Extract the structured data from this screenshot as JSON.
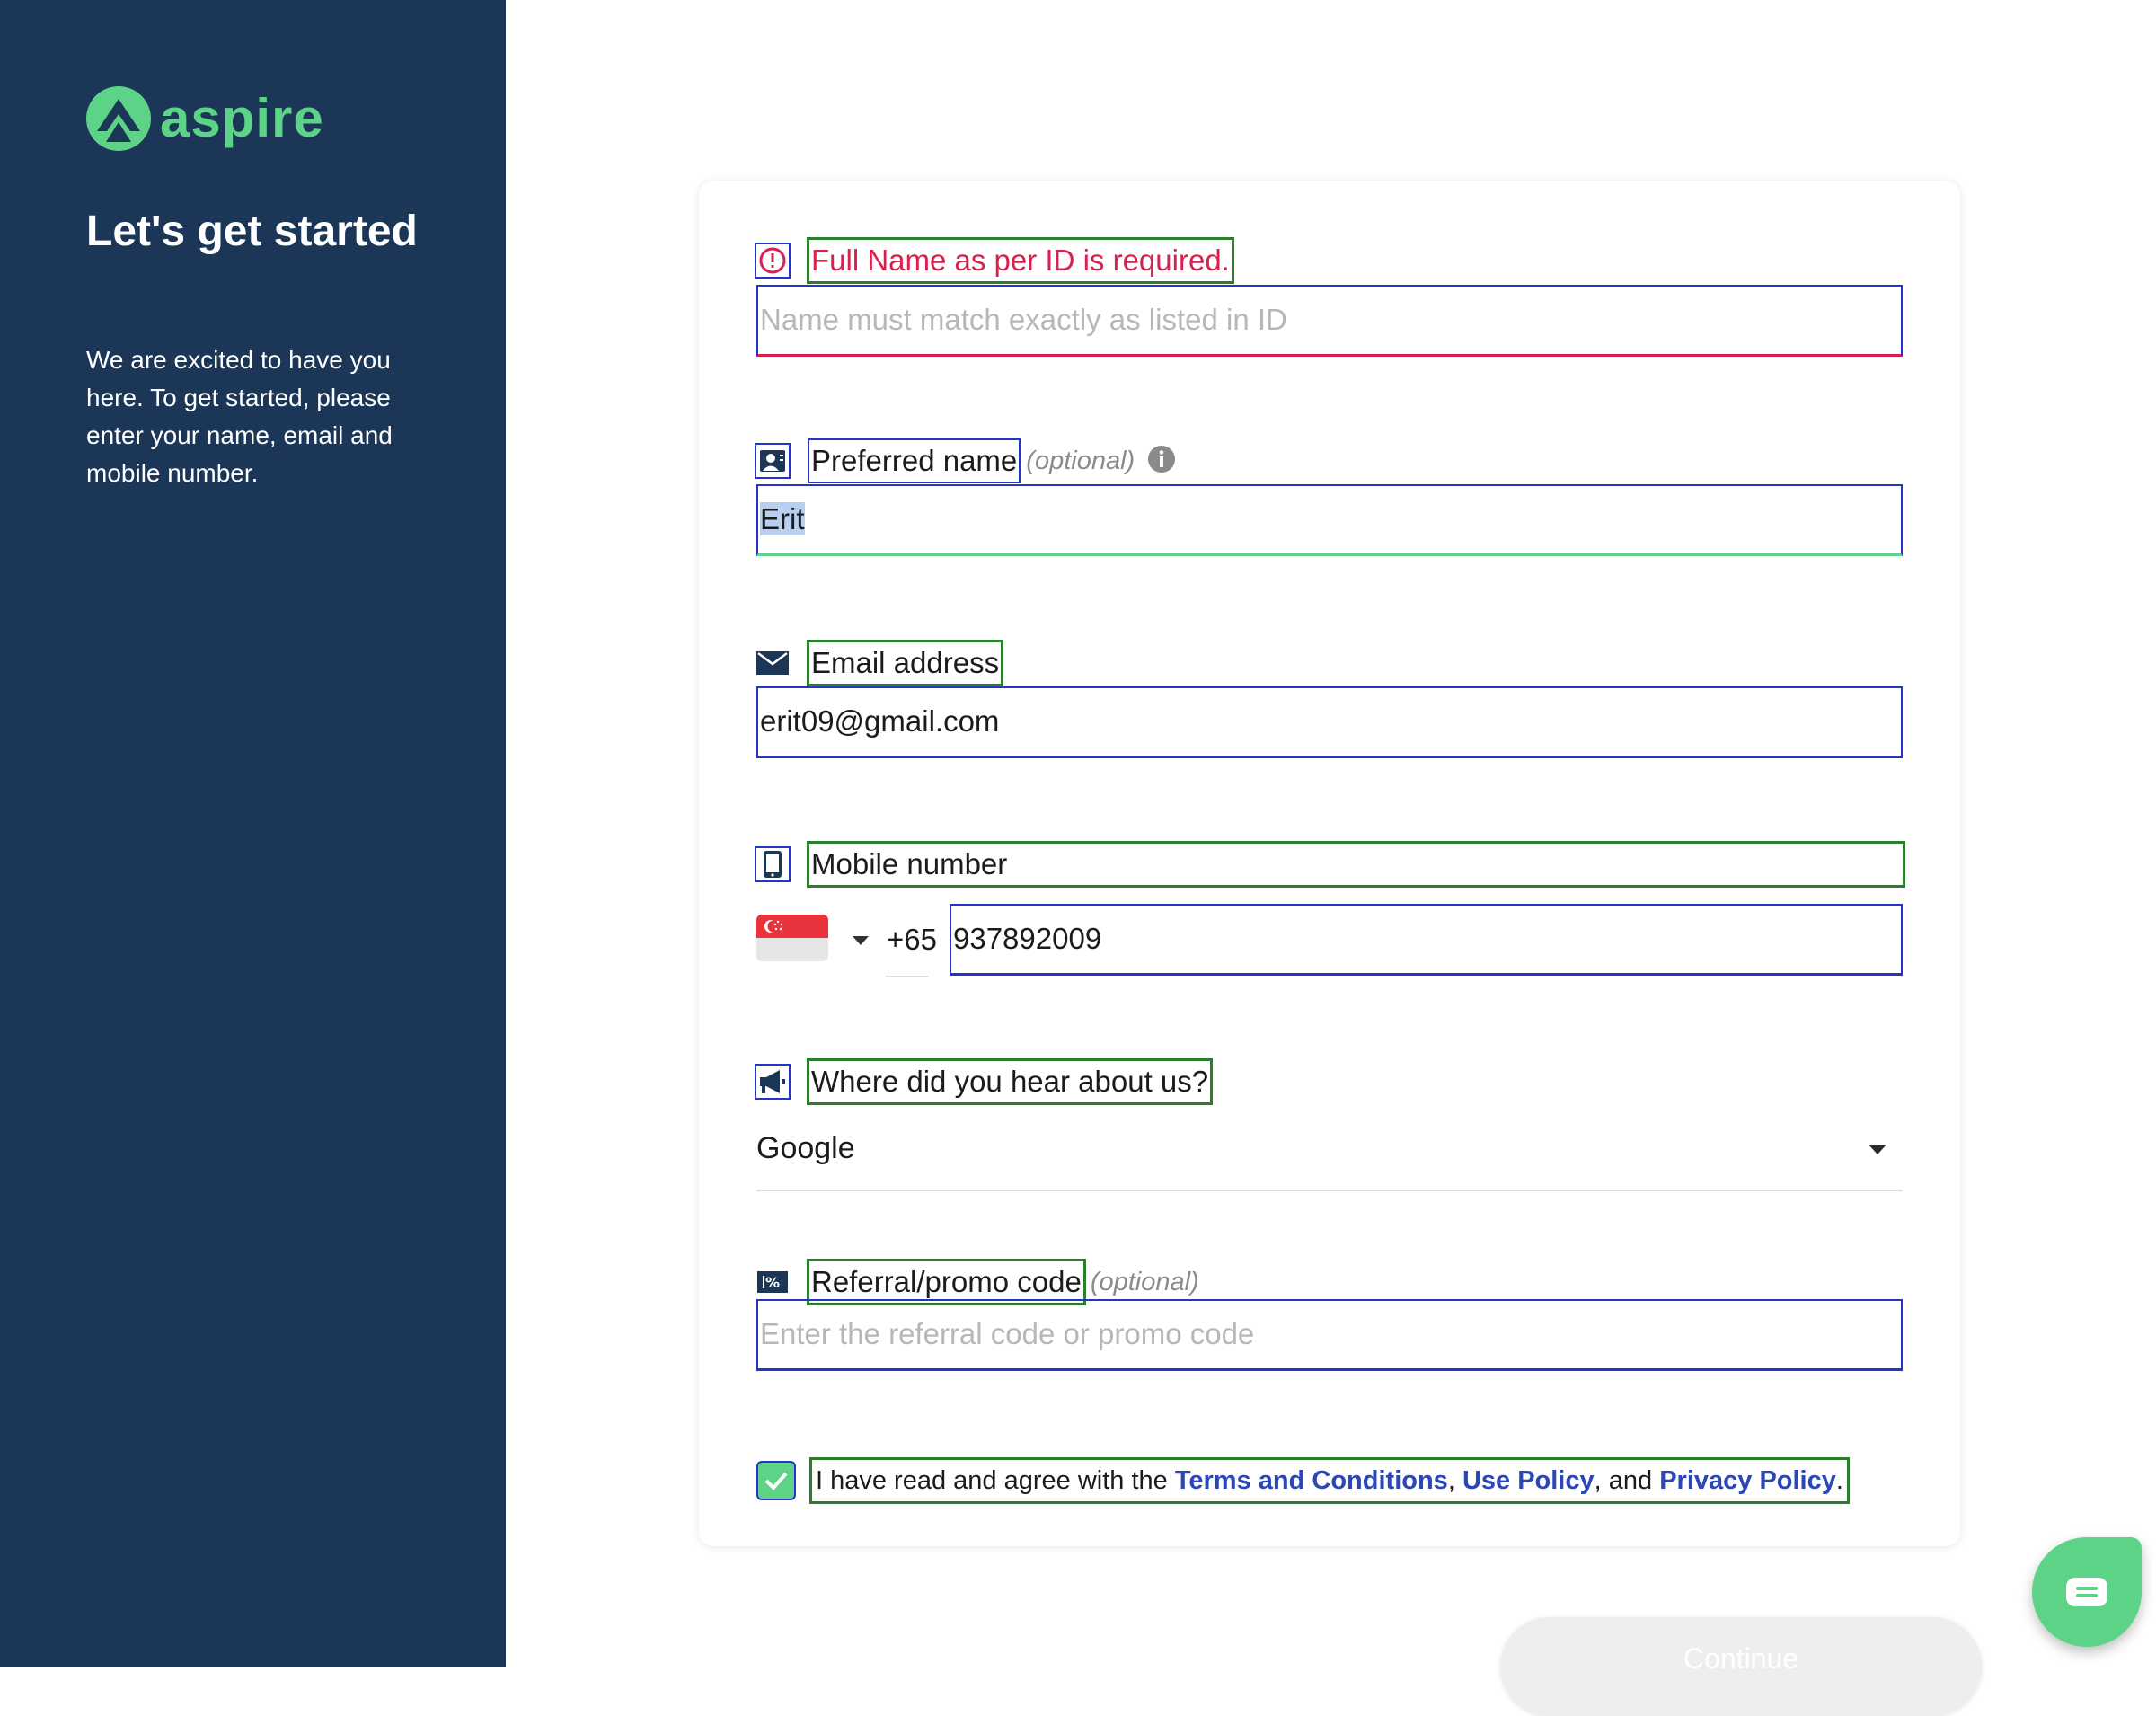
{
  "brand": {
    "name": "aspire",
    "color": "#5cd386"
  },
  "sidebar": {
    "title": "Let's get started",
    "description": "We are excited to have you here. To get started, please enter your name, email and mobile number."
  },
  "form": {
    "full_name": {
      "error": "Full Name as per ID is required.",
      "placeholder": "Name must match exactly as listed in ID",
      "value": ""
    },
    "preferred_name": {
      "label": "Preferred name",
      "optional": "(optional)",
      "value": "Erit"
    },
    "email": {
      "label": "Email address",
      "value": "erit09@gmail.com"
    },
    "mobile": {
      "label": "Mobile number",
      "country_code": "+65",
      "value": "937892009"
    },
    "hear_about": {
      "label": "Where did you hear about us?",
      "selected": "Google"
    },
    "referral": {
      "label": "Referral/promo code",
      "optional": "(optional)",
      "placeholder": "Enter the referral code or promo code"
    },
    "agreement": {
      "prefix": "I have read and agree with the ",
      "terms": "Terms and Conditions",
      "sep1": ", ",
      "use_policy": "Use Policy",
      "sep2": ", and ",
      "privacy": "Privacy Policy",
      "suffix": ".",
      "checked": true
    }
  },
  "actions": {
    "continue_label": "Continue"
  },
  "colors": {
    "sidebar_bg": "#1b3657",
    "error": "#d8214c",
    "link": "#2a47b5",
    "success": "#5cd386"
  }
}
